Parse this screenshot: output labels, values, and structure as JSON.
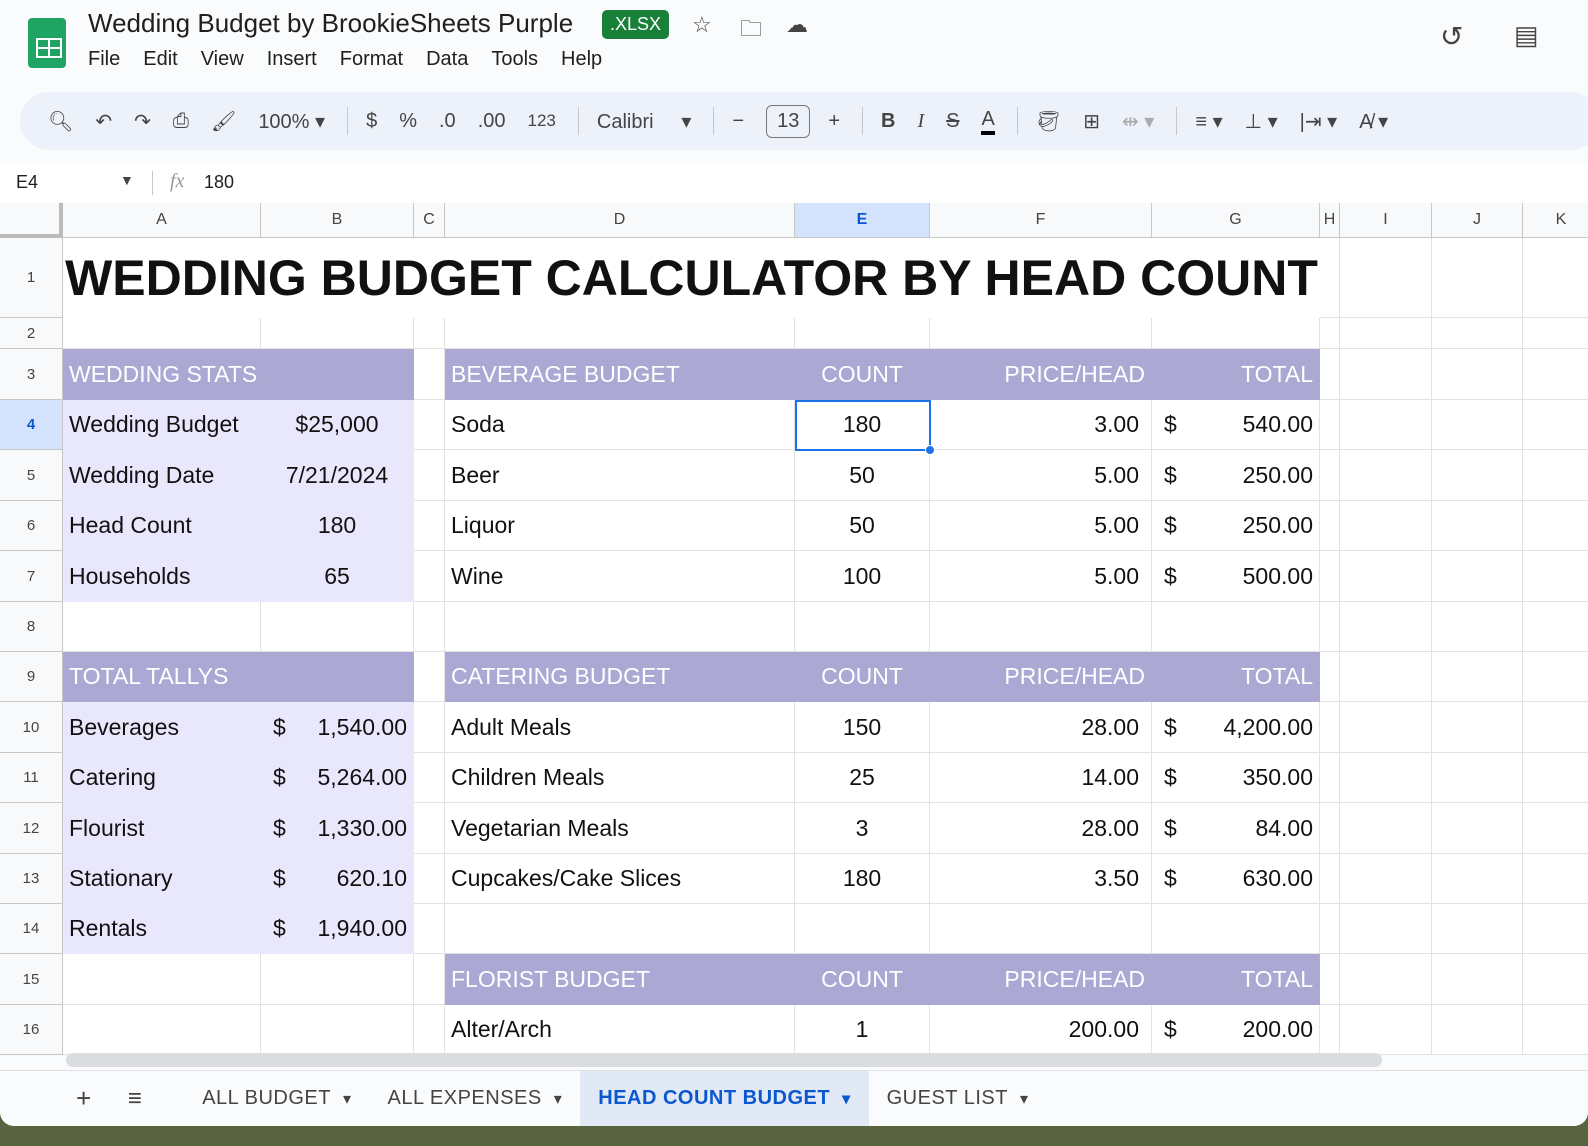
{
  "doc": {
    "title": "Wedding Budget by BrookieSheets Purple",
    "badge": ".XLSX"
  },
  "menu": [
    "File",
    "Edit",
    "View",
    "Insert",
    "Format",
    "Data",
    "Tools",
    "Help"
  ],
  "toolbar": {
    "zoom": "100%",
    "currency": "$",
    "percent": "%",
    "dec_less": ".0",
    "dec_more": ".00",
    "format": "123",
    "font": "Calibri",
    "font_size": "13"
  },
  "formula_bar": {
    "cell_ref": "E4",
    "fx": "fx",
    "value": "180"
  },
  "columns": [
    "A",
    "B",
    "C",
    "D",
    "E",
    "F",
    "G",
    "H",
    "I",
    "J",
    "K"
  ],
  "rows": [
    "1",
    "2",
    "3",
    "4",
    "5",
    "6",
    "7",
    "8",
    "9",
    "10",
    "11",
    "12",
    "13",
    "14",
    "15",
    "16"
  ],
  "title": "WEDDING BUDGET CALCULATOR BY HEAD COUNT",
  "stats": {
    "header": "WEDDING STATS",
    "items": [
      [
        "Wedding Budget",
        "$25,000"
      ],
      [
        "Wedding Date",
        "7/21/2024"
      ],
      [
        "Head Count",
        "180"
      ],
      [
        "Households",
        "65"
      ]
    ]
  },
  "tallies": {
    "header": "TOTAL TALLYS",
    "items": [
      [
        "Beverages",
        "$",
        "1,540.00"
      ],
      [
        "Catering",
        "$",
        "5,264.00"
      ],
      [
        "Flourist",
        "$",
        "1,330.00"
      ],
      [
        "Stationary",
        "$",
        "620.10"
      ],
      [
        "Rentals",
        "$",
        "1,940.00"
      ]
    ]
  },
  "budgets": [
    {
      "header": [
        "BEVERAGE BUDGET",
        "COUNT",
        "PRICE/HEAD",
        "TOTAL"
      ],
      "rows": [
        [
          "Soda",
          "180",
          "3.00",
          "$",
          "540.00"
        ],
        [
          "Beer",
          "50",
          "5.00",
          "$",
          "250.00"
        ],
        [
          "Liquor",
          "50",
          "5.00",
          "$",
          "250.00"
        ],
        [
          "Wine",
          "100",
          "5.00",
          "$",
          "500.00"
        ]
      ]
    },
    {
      "header": [
        "CATERING BUDGET",
        "COUNT",
        "PRICE/HEAD",
        "TOTAL"
      ],
      "rows": [
        [
          "Adult Meals",
          "150",
          "28.00",
          "$",
          "4,200.00"
        ],
        [
          "Children Meals",
          "25",
          "14.00",
          "$",
          "350.00"
        ],
        [
          "Vegetarian Meals",
          "3",
          "28.00",
          "$",
          "84.00"
        ],
        [
          "Cupcakes/Cake Slices",
          "180",
          "3.50",
          "$",
          "630.00"
        ]
      ]
    },
    {
      "header": [
        "FLORIST BUDGET",
        "COUNT",
        "PRICE/HEAD",
        "TOTAL"
      ],
      "rows": [
        [
          "Alter/Arch",
          "1",
          "200.00",
          "$",
          "200.00"
        ]
      ]
    }
  ],
  "tabs": [
    "ALL BUDGET",
    "ALL EXPENSES",
    "HEAD COUNT BUDGET",
    "GUEST LIST"
  ],
  "active_tab": "HEAD COUNT BUDGET",
  "colors": {
    "header": "#aba8d4",
    "lavender": "#e9e7fb",
    "accent": "#1a73e8"
  }
}
